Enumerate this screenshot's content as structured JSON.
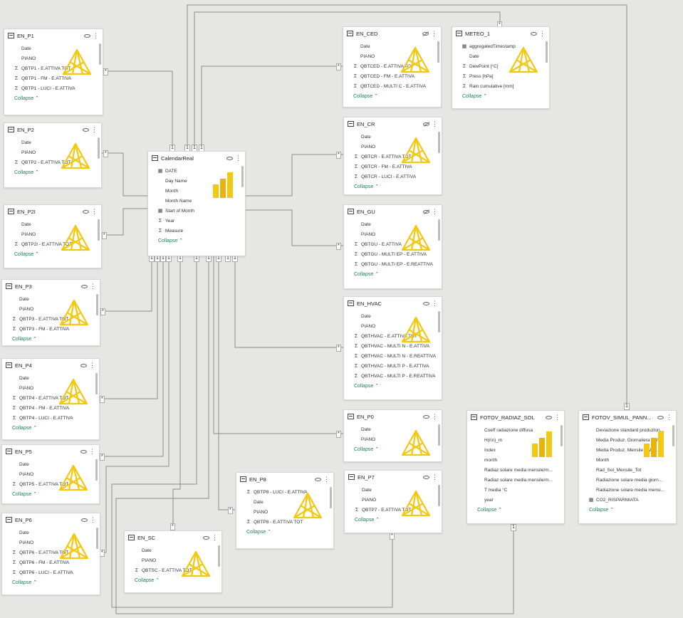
{
  "tables": {
    "en_p1": {
      "name": "EN_P1",
      "fields": [
        "Date",
        "PIANO",
        "QBTP1 - E.ATTIVA TOT",
        "QBTP1 - FM - E.ATTIVA",
        "QBTP1 - LUCI - E.ATTIVA"
      ],
      "collapse": "Collapse"
    },
    "en_p2": {
      "name": "EN_P2",
      "fields": [
        "Date",
        "PIANO",
        "QBTP2 - E.ATTIVA TOT"
      ],
      "collapse": "Collapse"
    },
    "en_p2i": {
      "name": "EN_P2I",
      "fields": [
        "Date",
        "PIANO",
        "QBTP2I - E.ATTIVA TOT"
      ],
      "collapse": "Collapse"
    },
    "en_p3": {
      "name": "EN_P3",
      "fields": [
        "Date",
        "PIANO",
        "QBTP3 - E.ATTIVA TOT",
        "QBTP3 - FM - E.ATTIVA"
      ],
      "collapse": "Collapse"
    },
    "en_p4": {
      "name": "EN_P4",
      "fields": [
        "Date",
        "PIANO",
        "QBTP4 - E.ATTIVA TOT",
        "QBTP4 - FM - E.ATTIVA",
        "QBTP4 - LUCI - E.ATTIVA"
      ],
      "collapse": "Collapse"
    },
    "en_p5": {
      "name": "EN_P5",
      "fields": [
        "Date",
        "PIANO",
        "QBTP5 - E.ATTIVA TOT"
      ],
      "collapse": "Collapse"
    },
    "en_p6": {
      "name": "EN_P6",
      "fields": [
        "Date",
        "PIANO",
        "QBTP6 - E.ATTIVA TOT",
        "QBTP6 - FM - E.ATTIVA",
        "QBTP6 - LUCI - E.ATTIVA"
      ],
      "collapse": "Collapse"
    },
    "en_sc": {
      "name": "EN_SC",
      "fields": [
        "Date",
        "PIANO",
        "QBTSC - E.ATTIVA TOT"
      ],
      "collapse": "Collapse"
    },
    "en_p8": {
      "name": "EN_P8",
      "fields": [
        "QBTP8 - LUCI - E.ATTIVA",
        "Date",
        "PIANO",
        "QBTP8 - E.ATTIVA TOT"
      ],
      "collapse": "Collapse"
    },
    "en_p7": {
      "name": "EN_P7",
      "fields": [
        "Date",
        "PIANO",
        "QBTP7 - E.ATTIVA TOT"
      ],
      "collapse": "Collapse"
    },
    "en_p0": {
      "name": "EN_P0",
      "fields": [
        "Date",
        "PIANO"
      ],
      "collapse": "Collapse"
    },
    "en_hvac": {
      "name": "EN_HVAC",
      "fields": [
        "Date",
        "PIANO",
        "QBTHVAC - E.ATTIVA TOT",
        "QBTHVAC - MULTI N - E.ATTIVA",
        "QBTHVAC - MULTI N - E.REATTIVA",
        "QBTHVAC - MULTI P - E.ATTIVA",
        "QBTHVAC - MULTI P - E.REATTIVA"
      ],
      "collapse": "Collapse"
    },
    "en_gu": {
      "name": "EN_GU",
      "fields": [
        "Date",
        "PIANO",
        "QBTGU - E.ATTIVA",
        "QBTGU - MULTI EP - E.ATTIVA",
        "QBTGU - MULTI EP - E.REATTIVA"
      ],
      "collapse": "Collapse"
    },
    "en_cr": {
      "name": "EN_CR",
      "fields": [
        "Date",
        "PIANO",
        "QBTCR - E.ATTIVA TOT",
        "QBTCR - FM - E.ATTIVA",
        "QBTCR - LUCI - E.ATTIVA"
      ],
      "collapse": "Collapse"
    },
    "en_ced": {
      "name": "EN_CED",
      "fields": [
        "Date",
        "PIANO",
        "QBTCED - E.ATTIVA TOT",
        "QBTCED - FM - E.ATTIVA",
        "QBTCED - MULTI C - E.ATTIVA"
      ],
      "collapse": "Collapse"
    },
    "meteo_1": {
      "name": "METEO_1",
      "fields": [
        "aggregatedTimestamp",
        "Date",
        "DewPoint [°C]",
        "Press [hPa]",
        "Rain cumulative [mm]"
      ],
      "collapse": "Collapse"
    },
    "calendar": {
      "name": "CalendarReal",
      "fields": [
        "DATE",
        "Day Name",
        "Month",
        "Month Name",
        "Start of Month",
        "Year",
        "Measure"
      ],
      "collapse": "Collapse"
    },
    "fotov_radiaz": {
      "name": "FOTOV_RADIAZ_SOL",
      "fields": [
        "Coeff radiazione diffusa",
        "H(rin)_m",
        "Index",
        "month",
        "Radiaz solare media mensile/m...",
        "Radiaz solare media mensile/m...",
        "T media °C",
        "year"
      ],
      "collapse": "Collapse"
    },
    "fotov_simul": {
      "name": "FOTOV_SIMUL_PANN...",
      "fields": [
        "Deviazione standard produzion...",
        "Media Produz. Giornaliera kWh...",
        "Media Produz. Mensile kWh...",
        "Month",
        "Rad_Sol_Mensile_Tot",
        "Radiazione solare media giorn...",
        "Radiazione solare media mensi...",
        "CO2_RISPARMIATA"
      ],
      "collapse": "Collapse"
    }
  },
  "relation_labels": {
    "one": "1",
    "many": "*"
  },
  "colors": {
    "line": "#8c8c8c",
    "accent": "#1e7b66",
    "logo": "#f2c811"
  }
}
